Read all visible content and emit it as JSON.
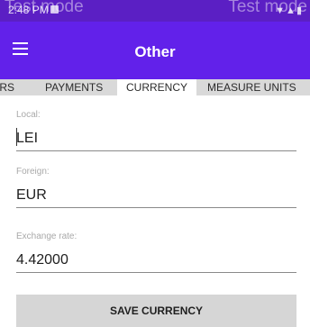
{
  "status_bar": {
    "time": "2:48 PM",
    "watermark_left": "Test mode",
    "watermark_right": "Test mode"
  },
  "app_bar": {
    "title": "Other",
    "menu_icon": "hamburger-menu-icon"
  },
  "tabs": [
    {
      "label": "ORS",
      "active": false
    },
    {
      "label": "PAYMENTS",
      "active": false
    },
    {
      "label": "CURRENCY",
      "active": true
    },
    {
      "label": "MEASURE UNITS",
      "active": false
    }
  ],
  "form": {
    "local": {
      "label": "Local:",
      "value": "LEI"
    },
    "foreign": {
      "label": "Foreign:",
      "value": "EUR"
    },
    "exchange_rate": {
      "label": "Exchange rate:",
      "value": "4.42000"
    }
  },
  "save_button": {
    "label": "SAVE CURRENCY"
  },
  "colors": {
    "status_bar": "#5b1fc4",
    "app_bar": "#6221ea",
    "tab_strip": "#d9d9d9",
    "button": "#d6d6d6"
  }
}
